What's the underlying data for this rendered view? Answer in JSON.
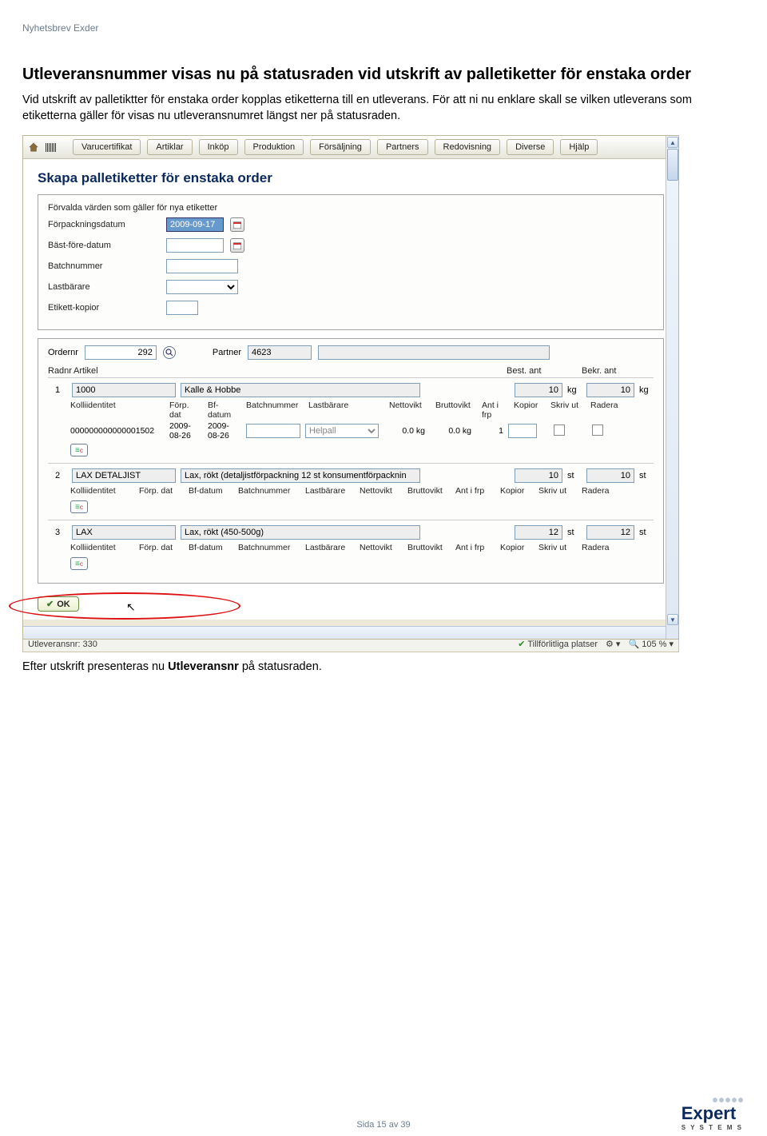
{
  "doc": {
    "header": "Nyhetsbrev Exder",
    "section_title": "Utleveransnummer visas nu på statusraden vid utskrift av palletiketter för enstaka order",
    "body_text": "Vid utskrift av palletiktter för enstaka order kopplas etiketterna till en utleverans. För att ni nu enklare skall se vilken utleverans som etiketterna gäller för visas nu utleveransnumret längst ner på statusraden.",
    "caption_after_prefix": "Efter utskrift presenteras nu ",
    "caption_after_bold": "Utleveransnr",
    "caption_after_suffix": " på statusraden.",
    "footer": "Sida 15 av 39",
    "logo_main": "Expert",
    "logo_sub": "S Y S T E M S"
  },
  "app": {
    "menus": [
      "Varucertifikat",
      "Artiklar",
      "Inköp",
      "Produktion",
      "Försäljning",
      "Partners",
      "Redovisning",
      "Diverse",
      "Hjälp"
    ],
    "title": "Skapa palletiketter för enstaka order",
    "form_intro": "Förvalda värden som gäller för nya etiketter",
    "labels": {
      "forpackning": "Förpackningsdatum",
      "bast": "Bäst-före-datum",
      "batch": "Batchnummer",
      "lastbarare": "Lastbärare",
      "kopior": "Etikett-kopior",
      "ordernr": "Ordernr",
      "partner": "Partner",
      "radnr": "Radnr",
      "artikel": "Artikel",
      "best_ant": "Best. ant",
      "bekr_ant": "Bekr. ant"
    },
    "form": {
      "date": "2009-09-17"
    },
    "order": {
      "ordernr": "292",
      "partner_id": "4623",
      "partner_name": ""
    },
    "subcols": {
      "kolli": "Kolliidentitet",
      "forp_dat": "Förp. dat",
      "forp_dat_split": "Förp.\ndat",
      "bf_datum": "Bf-datum",
      "bf_datum_split": "Bf-\ndatum",
      "batch": "Batchnummer",
      "lastbarare": "Lastbärare",
      "netto": "Nettovikt",
      "brutto": "Bruttovikt",
      "ant_i_frp": "Ant i frp",
      "ant_i_frp_split": "Ant i\nfrp",
      "kopior": "Kopior",
      "skriv": "Skriv ut",
      "radera": "Radera"
    },
    "rows": [
      {
        "nr": "1",
        "art": "1000",
        "desc": "Kalle & Hobbe",
        "best": "10",
        "unit": "kg",
        "bekr": "10",
        "kolli": "000000000000001502",
        "forp": "2009-08-26",
        "bf": "2009-08-26",
        "lastbarare_sel": "Helpall",
        "netto": "0.0 kg",
        "brutto": "0.0 kg",
        "ant": "1"
      },
      {
        "nr": "2",
        "art": "LAX DETALJIST",
        "desc": "Lax, rökt (detaljistförpackning 12 st konsumentförpacknin",
        "best": "10",
        "unit": "st",
        "bekr": "10"
      },
      {
        "nr": "3",
        "art": "LAX",
        "desc": "Lax, rökt (450-500g)",
        "best": "12",
        "unit": "st",
        "bekr": "12"
      }
    ],
    "ok": "OK",
    "status_left": "Utleveransnr: 330",
    "status_right1": "Tillförlitliga platser",
    "status_right2": "105 %"
  }
}
